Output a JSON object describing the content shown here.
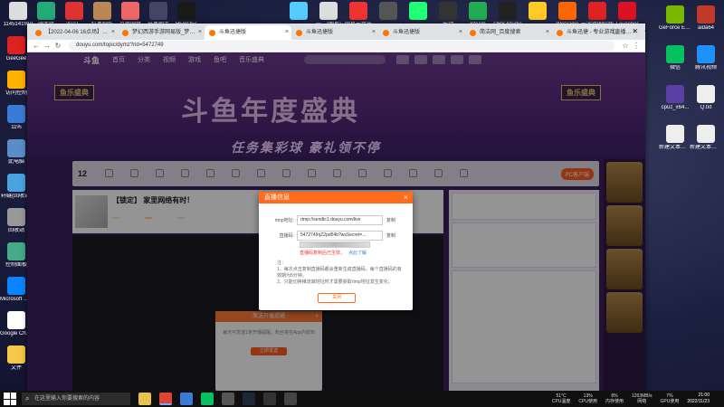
{
  "desktop": {
    "left_icons": [
      "GeeGee",
      "访问控制",
      "11%",
      "此电脑",
      "轩缝(回收站)",
      "回收站",
      "控制面板",
      "Microsoft Edge",
      "Google Chrome",
      "文件"
    ],
    "top_icons": [
      "1145141919",
      "萌大佬",
      "2022...",
      "红黑制作",
      "百度网盘",
      "开黑助手",
      "HEROEs",
      "",
      "一二(图片)",
      "网易云音乐",
      "",
      "",
      "乐动",
      "Steam",
      "OBS Studio",
      "",
      "WeGame",
      "云游戏国际版",
      "Launcher"
    ],
    "right_icons": [
      {
        "label": "GeForce Experience",
        "color": "#76b900"
      },
      {
        "label": "aida64",
        "color": "#c0392b"
      },
      {
        "label": "微信",
        "color": "#07c160"
      },
      {
        "label": "腾讯视频",
        "color": "#1e90ff"
      },
      {
        "label": "cpuz_x64...",
        "color": "#5b3fa6"
      },
      {
        "label": "Q.txt",
        "color": "#eeeeee"
      },
      {
        "label": "新建文本文档.txt",
        "color": "#eeeeee"
      },
      {
        "label": "新建文本文档 (4).txt",
        "color": "#eeeeee"
      }
    ]
  },
  "browser": {
    "tabs": [
      "【2022-04-06 16点场】星秀...",
      "梦幻西游手游网易版_梦幻西游...",
      "斗鱼迅捷版",
      "斗鱼迅捷版",
      "斗鱼迅捷版",
      "简洁网_百度搜索",
      "斗鱼迅捷 - 专业游戏直播平台..."
    ],
    "active_tab": 2,
    "url": "douyu.com/topic/dymz?rid=5472749"
  },
  "page": {
    "logo": "斗鱼",
    "nav": [
      "首页",
      "分类",
      "视频",
      "游戏",
      "鱼吧",
      "音乐盛典"
    ],
    "banner_title": "斗鱼年度盛典",
    "banner_sub": "任务集彩球  豪礼领不停",
    "badge": "鱼乐盛典",
    "room_count": "12",
    "toolbar": [
      "",
      "",
      "",
      "",
      "",
      "",
      "",
      "",
      "",
      "",
      "",
      "",
      "",
      "",
      ""
    ],
    "pc_button": "PC客户端",
    "room_title": "【锁定】 家里网络有时！",
    "room_tags": [
      "",
      "",
      ""
    ],
    "sidebar_heads": [
      "",
      "",
      ""
    ],
    "sidebar_chat": "",
    "send_panel": {
      "title": "发送开播提醒",
      "body": "每天可发送1条开播提醒，粉丝将在App内收到",
      "button": "立即发送"
    }
  },
  "modal": {
    "title": "直播信息",
    "close": "×",
    "rtmp_label": "rtmp地址:",
    "rtmp_value": "rtmp://sendtc1.douyu.com/live",
    "key_label": "直播码:",
    "key_value": "5472749rjZ2pd54b?wsSecret=...",
    "copy": "复制",
    "warning": "直播码复制后已生效，",
    "warning_link": "点此了解",
    "notes_title": "注：",
    "notes": [
      "1、每次点击复制直播码都会重新生成直播码，每个直播码的有效期为5分钟。",
      "2、只能切换推流端地址时才需要获取rtmp地址发生变化。"
    ],
    "ok": "关闭"
  },
  "taskbar": {
    "search_placeholder": "在这里输入你要搜索的内容",
    "stats": [
      {
        "value": "51°C",
        "label": "CPU温度"
      },
      {
        "value": "13%",
        "label": "CPU使用"
      },
      {
        "value": "8%",
        "label": "内存使用"
      },
      {
        "value": "1263MB/s",
        "label": "网络"
      },
      {
        "value": "7%",
        "label": "GPU使用"
      }
    ],
    "time": "21:00",
    "date": "2022/11/23"
  }
}
